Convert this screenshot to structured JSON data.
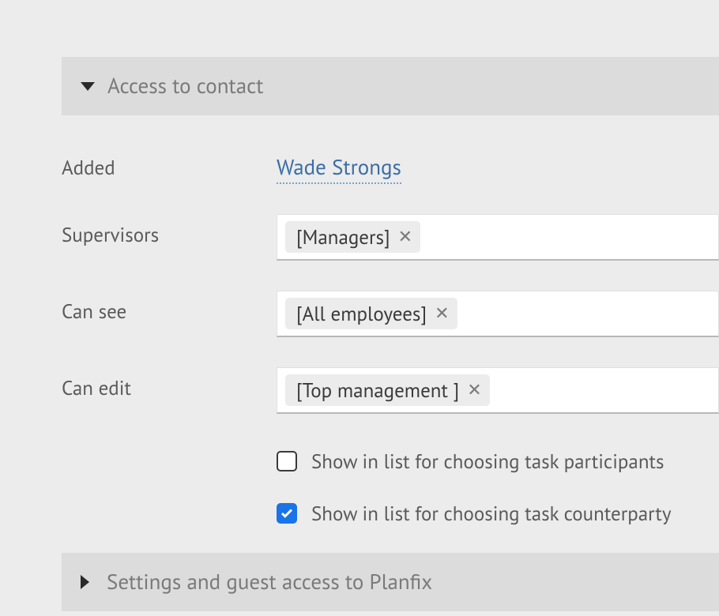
{
  "sections": {
    "access": {
      "title": "Access to contact",
      "expanded": true
    },
    "settings": {
      "title": "Settings and guest access to Planfix",
      "expanded": false
    }
  },
  "form": {
    "added": {
      "label": "Added",
      "user": "Wade Strongs"
    },
    "supervisors": {
      "label": "Supervisors",
      "tags": [
        "[Managers]"
      ]
    },
    "can_see": {
      "label": "Can see",
      "tags": [
        "[All employees]"
      ]
    },
    "can_edit": {
      "label": "Can edit",
      "tags": [
        "[Top management ]"
      ]
    }
  },
  "checkboxes": {
    "participants": {
      "label": "Show in list for choosing task participants",
      "checked": false
    },
    "counterparty": {
      "label": "Show in list for choosing task counterparty",
      "checked": true
    }
  }
}
